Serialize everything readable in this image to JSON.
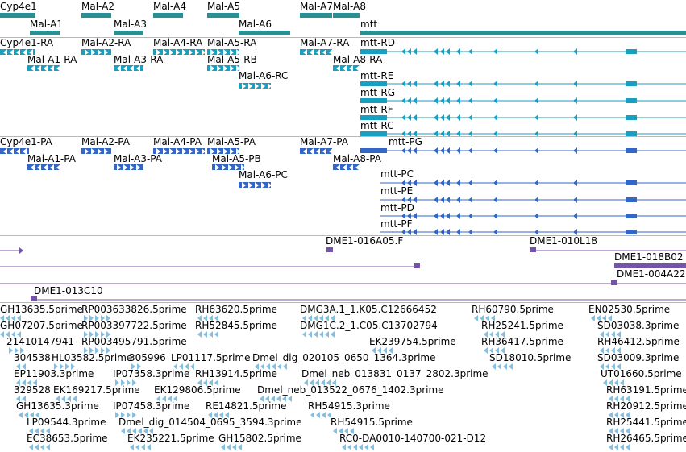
{
  "colors": {
    "gene": "#2a8f94",
    "transcript": "#17a0c2",
    "protein": "#3366c9",
    "clone": "#7454a8",
    "est": "#86bede"
  },
  "genes": [
    {
      "label": "Cyp4e1",
      "strand": "-"
    },
    {
      "label": "Mal-A1",
      "strand": "-"
    },
    {
      "label": "Mal-A2",
      "strand": "+"
    },
    {
      "label": "Mal-A3",
      "strand": "-"
    },
    {
      "label": "Mal-A4",
      "strand": "+"
    },
    {
      "label": "Mal-A5",
      "strand": "+"
    },
    {
      "label": "Mal-A6",
      "strand": "+"
    },
    {
      "label": "Mal-A7",
      "strand": "-"
    },
    {
      "label": "Mal-A8",
      "strand": "-"
    },
    {
      "label": "mtt",
      "strand": "-"
    }
  ],
  "transcripts": [
    {
      "label": "Cyp4e1-RA"
    },
    {
      "label": "Mal-A1-RA"
    },
    {
      "label": "Mal-A2-RA"
    },
    {
      "label": "Mal-A3-RA"
    },
    {
      "label": "Mal-A4-RA"
    },
    {
      "label": "Mal-A5-RA"
    },
    {
      "label": "Mal-A5-RB"
    },
    {
      "label": "Mal-A6-RC"
    },
    {
      "label": "Mal-A7-RA"
    },
    {
      "label": "Mal-A8-RA"
    },
    {
      "label": "mtt-RD"
    },
    {
      "label": "mtt-RE"
    },
    {
      "label": "mtt-RG"
    },
    {
      "label": "mtt-RF"
    },
    {
      "label": "mtt-RC"
    }
  ],
  "proteins": [
    {
      "label": "Cyp4e1-PA"
    },
    {
      "label": "Mal-A1-PA"
    },
    {
      "label": "Mal-A2-PA"
    },
    {
      "label": "Mal-A3-PA"
    },
    {
      "label": "Mal-A4-PA"
    },
    {
      "label": "Mal-A5-PA"
    },
    {
      "label": "Mal-A5-PB"
    },
    {
      "label": "Mal-A6-PC"
    },
    {
      "label": "Mal-A7-PA"
    },
    {
      "label": "Mal-A8-PA"
    },
    {
      "label": "mtt-PG"
    },
    {
      "label": "mtt-PC"
    },
    {
      "label": "mtt-PE"
    },
    {
      "label": "mtt-PD"
    },
    {
      "label": "mtt-PF"
    }
  ],
  "clones": [
    {
      "label": "DME1-016A05.F"
    },
    {
      "label": "DME1-010L18"
    },
    {
      "label": "DME1-018B02"
    },
    {
      "label": "DME1-004A22"
    },
    {
      "label": "DME1-013C10"
    }
  ],
  "ests": [
    "GH13635.5prime",
    "RP003633826.5prime",
    "RH63620.5prime",
    "DMG3A.1_1.K05.C12666452",
    "RH60790.5prime",
    "EN02530.5prime",
    "GH07207.5prime",
    "RP003397722.5prime",
    "RH52845.5prime",
    "DMG1C.2_1.C05.C13702794",
    "RH25241.5prime",
    "SD03038.3prime",
    "21410147941",
    "RP003495791.5prime",
    "EK239754.5prime",
    "RH36417.5prime",
    "RH46412.5prime",
    "304538",
    "HL03582.5prime",
    "305996",
    "LP01117.5prime",
    "Dmel_dig_020105_0650_1364.3prime",
    "SD18010.5prime",
    "SD03009.3prime",
    "EP11903.3prime",
    "IP07358.3prime",
    "RH13914.5prime",
    "Dmel_neb_013831_0137_2802.3prime",
    "UT01660.5prime",
    "329528",
    "EK169217.5prime",
    "EK129806.5prime",
    "Dmel_neb_013522_0676_1402.3prime",
    "RH63191.5prime",
    "GH13635.3prime",
    "IP07458.3prime",
    "RE14821.5prime",
    "RH54915.3prime",
    "RH20912.5prime",
    "LP09544.3prime",
    "Dmel_dig_014504_0695_3594.3prime",
    "RH54915.5prime",
    "RH25441.5prime",
    "EC38653.5prime",
    "EK235221.5prime",
    "GH15802.5prime",
    "RC0-DA0010-140700-021-D12",
    "RH26465.5prime"
  ]
}
